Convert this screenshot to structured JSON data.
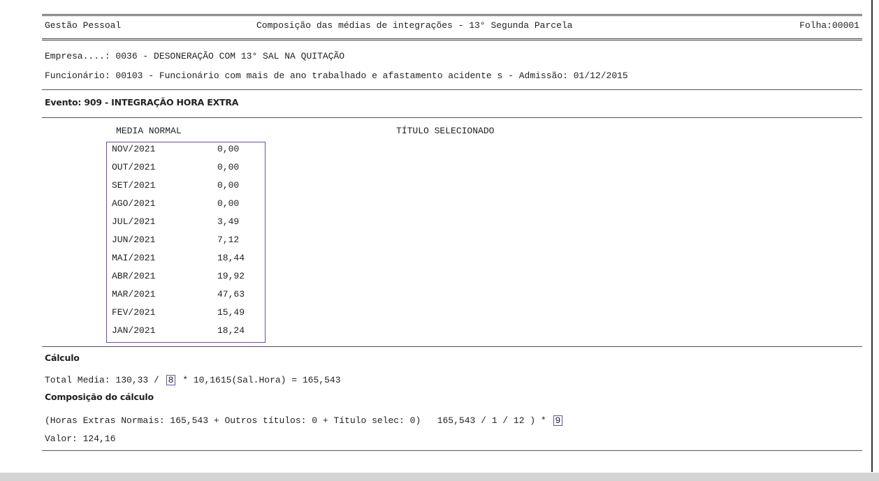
{
  "header": {
    "left": "Gestão Pessoal",
    "title": "Composição das médias de integrações - 13° Segunda Parcela",
    "sheet": "Folha:00001"
  },
  "company": {
    "line": "Empresa....: 0036 - DESONERAÇÃO COM 13° SAL NA QUITAÇÃO"
  },
  "employee": {
    "line": "Funcionário: 00103 - Funcionário com mais de ano trabalhado e afastamento acidente s - Admissão: 01/12/2015"
  },
  "event": {
    "title": "Evento: 909 - INTEGRAÇÃO HORA EXTRA"
  },
  "columns": {
    "normal": "MEDIA NORMAL",
    "selected": "TÍTULO SELECIONADO"
  },
  "averages": [
    {
      "month": "NOV/2021",
      "value": "0,00"
    },
    {
      "month": "OUT/2021",
      "value": "0,00"
    },
    {
      "month": "SET/2021",
      "value": "0,00"
    },
    {
      "month": "AGO/2021",
      "value": "0,00"
    },
    {
      "month": "JUL/2021",
      "value": "3,49"
    },
    {
      "month": "JUN/2021",
      "value": "7,12"
    },
    {
      "month": "MAI/2021",
      "value": "18,44"
    },
    {
      "month": "ABR/2021",
      "value": "19,92"
    },
    {
      "month": "MAR/2021",
      "value": "47,63"
    },
    {
      "month": "FEV/2021",
      "value": "15,49"
    },
    {
      "month": "JAN/2021",
      "value": "18,24"
    }
  ],
  "calc": {
    "title": "Cálculo",
    "prefix": "Total Media: 130,33 / ",
    "divisor": "8",
    "suffix": " * 10,1615(Sal.Hora) = 165,543"
  },
  "composition": {
    "title": "Composição do cálculo",
    "prefix": "(Horas Extras Normais: 165,543 + Outros títulos: 0 + Título selec: 0)   165,543 / 1 / 12 ) * ",
    "multiplier": "9",
    "value": "Valor: 124,16"
  }
}
